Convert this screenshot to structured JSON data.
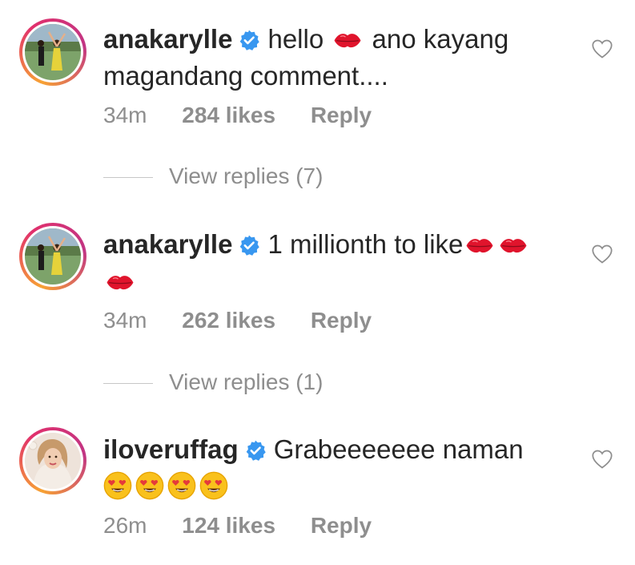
{
  "comments": [
    {
      "username": "anakarylle",
      "verified": true,
      "text_parts": [
        "hello",
        "ano kayang",
        "magandang comment...."
      ],
      "emoji": [
        "kiss-mark-icon"
      ],
      "time": "34m",
      "likes": "284 likes",
      "reply_label": "Reply",
      "view_replies": "View replies (7)"
    },
    {
      "username": "anakarylle",
      "verified": true,
      "text_parts": [
        "1 millionth to like"
      ],
      "emoji": [
        "kiss-mark-icon",
        "kiss-mark-icon",
        "kiss-mark-icon"
      ],
      "time": "34m",
      "likes": "262 likes",
      "reply_label": "Reply",
      "view_replies": "View replies (1)"
    },
    {
      "username": "iloveruffag",
      "verified": true,
      "text_parts": [
        "Grabeeeeeee naman"
      ],
      "emoji": [
        "heart-eyes-icon",
        "heart-eyes-icon",
        "heart-eyes-icon",
        "heart-eyes-icon"
      ],
      "time": "26m",
      "likes": "124 likes",
      "reply_label": "Reply"
    }
  ],
  "colors": {
    "text": "#262626",
    "secondary": "#8e8e8e",
    "verified": "#3897f0",
    "kiss": "#e0142c",
    "story_ring_start": "#f7a234",
    "story_ring_end": "#c13584"
  }
}
